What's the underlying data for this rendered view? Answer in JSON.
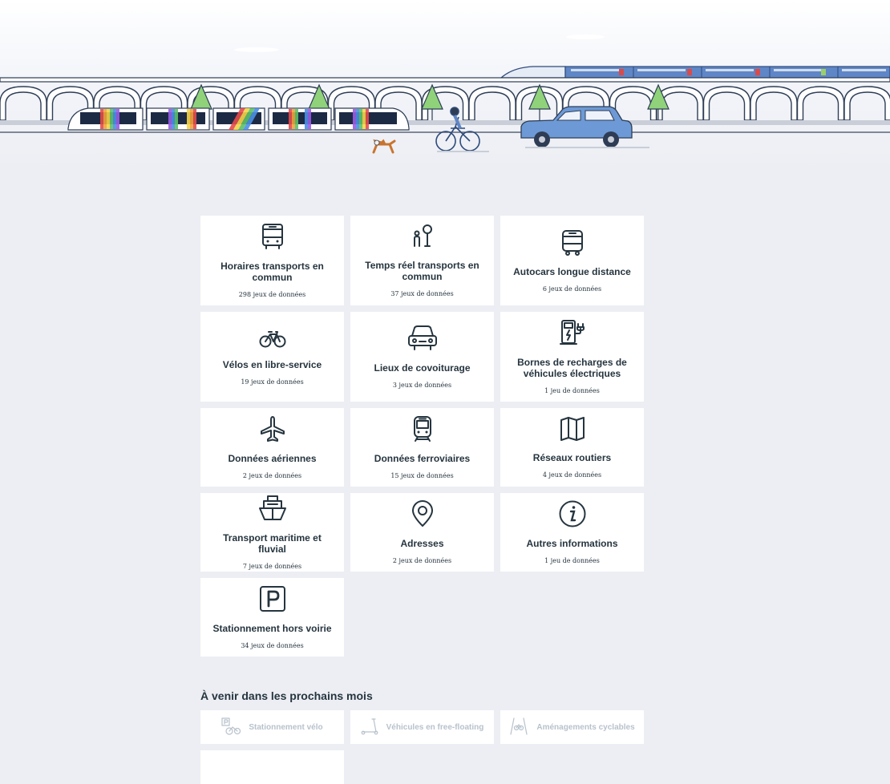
{
  "categories": [
    {
      "title": "Horaires transports en commun",
      "count": "298 jeux de données",
      "icon": "bus-icon"
    },
    {
      "title": "Temps réel transports en commun",
      "count": "37 jeux de données",
      "icon": "bus-stop-icon"
    },
    {
      "title": "Autocars longue distance",
      "count": "6 jeux de données",
      "icon": "coach-icon"
    },
    {
      "title": "Vélos en libre-service",
      "count": "19 jeux de données",
      "icon": "bicycle-icon"
    },
    {
      "title": "Lieux de covoiturage",
      "count": "3 jeux de données",
      "icon": "car-icon"
    },
    {
      "title": "Bornes de recharges de véhicules électriques",
      "count": "1 jeu de données",
      "icon": "charging-station-icon"
    },
    {
      "title": "Données aériennes",
      "count": "2 jeux de données",
      "icon": "airplane-icon"
    },
    {
      "title": "Données ferroviaires",
      "count": "15 jeux de données",
      "icon": "train-icon"
    },
    {
      "title": "Réseaux routiers",
      "count": "4 jeux de données",
      "icon": "map-icon"
    },
    {
      "title": "Transport maritime et fluvial",
      "count": "7 jeux de données",
      "icon": "ship-icon"
    },
    {
      "title": "Adresses",
      "count": "2 jeux de données",
      "icon": "location-pin-icon"
    },
    {
      "title": "Autres informations",
      "count": "1 jeu de données",
      "icon": "info-icon"
    },
    {
      "title": "Stationnement hors voirie",
      "count": "34 jeux de données",
      "icon": "parking-icon"
    }
  ],
  "upcoming": {
    "title": "À venir dans les prochains mois",
    "items": [
      {
        "label": "Stationnement vélo",
        "icon": "bike-parking-icon"
      },
      {
        "label": "Véhicules en free-floating",
        "icon": "scooter-icon"
      },
      {
        "label": "Aménagements cyclables",
        "icon": "bike-lane-icon"
      }
    ]
  },
  "colors": {
    "background": "#eceef3",
    "card": "#ffffff",
    "text": "#26353f",
    "muted": "#b8c2cc",
    "accent_blue": "#5f86c6"
  }
}
